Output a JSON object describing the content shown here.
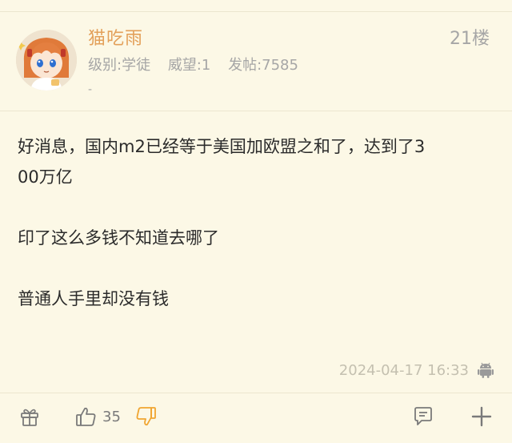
{
  "post": {
    "username": "猫吃雨",
    "floor": "21楼",
    "level": "级别:学徒",
    "prestige": "威望:1",
    "posts": "发帖:7585",
    "signature": "-",
    "content": {
      "paragraph1_line1": "好消息，国内m2已经等于美国加欧盟之和了，达到了3",
      "paragraph1_line2": "00万亿",
      "paragraph2": "印了这么多钱不知道去哪了",
      "paragraph3": "普通人手里却没有钱"
    },
    "timestamp": "2024-04-17 16:33",
    "client_icon": "android-icon"
  },
  "actions": {
    "gift_icon": "gift-icon",
    "like_icon": "thumb-up-icon",
    "like_count": "35",
    "dislike_icon": "thumb-down-icon",
    "reply_icon": "comment-icon",
    "more_icon": "plus-icon"
  },
  "colors": {
    "background": "#fcf8e6",
    "username": "#e3a05a",
    "muted": "#a6a6a6",
    "dislike": "#f0a531"
  }
}
